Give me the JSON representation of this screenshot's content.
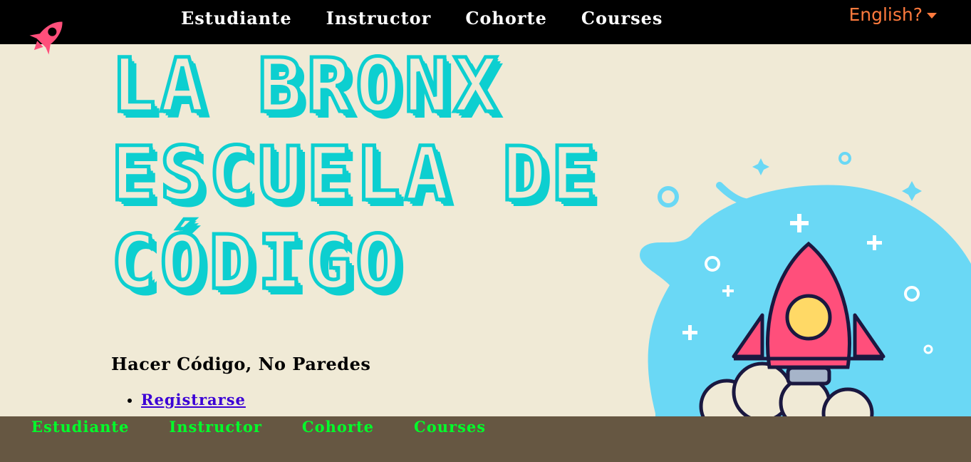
{
  "header": {
    "nav": [
      "Estudiante",
      "Instructor",
      "Cohorte",
      "Courses"
    ],
    "language_label": "English?",
    "logo_icon": "rocket-icon",
    "logo_color": "#ff4f7b"
  },
  "hero": {
    "title_line1": "La Bronx",
    "title_line2": "Escuela de",
    "title_line3": "Código",
    "title_color": "#0dcfd0",
    "tagline": "Hacer Código, No Paredes",
    "links": [
      "Registrarse"
    ],
    "illustration_icon": "rocket-launch-illustration"
  },
  "footer": {
    "nav": [
      "Estudiante",
      "Instructor",
      "Cohorte",
      "Courses"
    ],
    "link_color": "#00ff2a",
    "background": "#665742"
  }
}
